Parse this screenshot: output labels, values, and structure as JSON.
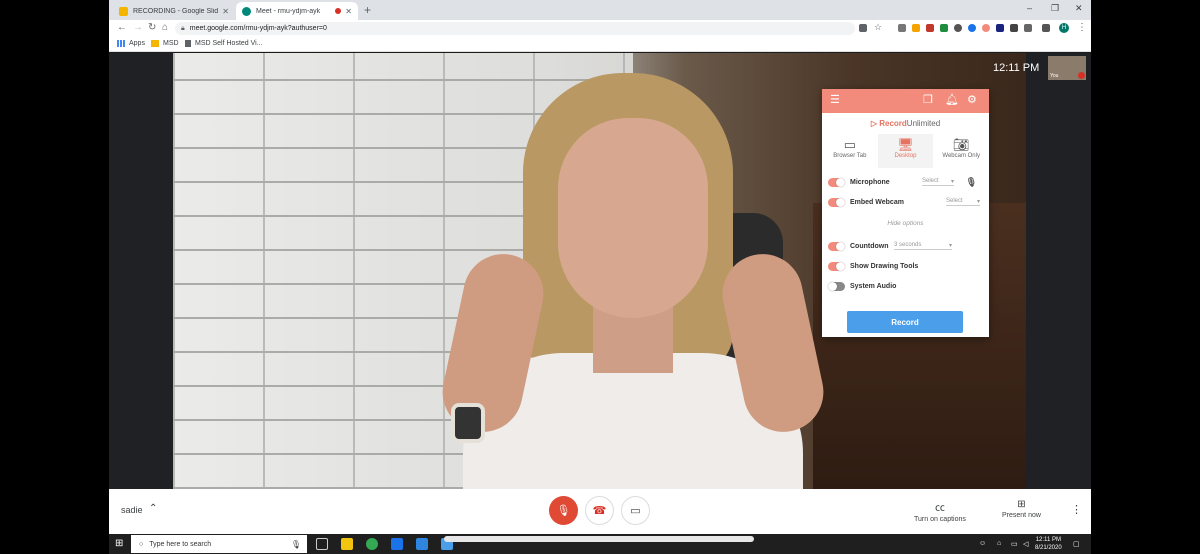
{
  "browser": {
    "tabs": [
      {
        "title": "RECORDING - Google Slides",
        "close": "✕"
      },
      {
        "title": "Meet - rmu-ydjm-ayk",
        "close": "✕"
      }
    ],
    "new_tab": "+",
    "url": "meet.google.com/rmu-ydjm-ayk?authuser=0",
    "profile_initial": "H",
    "bookmarks": [
      "Apps",
      "MSD",
      "MSD Self Hosted Vi..."
    ]
  },
  "meet": {
    "clock": "12:11 PM",
    "self_label": "You",
    "participant_name": "sadie",
    "captions_label": "Turn on captions",
    "present_label": "Present now"
  },
  "popup": {
    "brand_prefix": "Record",
    "brand_suffix": "Unlimited",
    "modes": [
      {
        "label": "Browser Tab",
        "icon": "browser-tab-icon"
      },
      {
        "label": "Desktop",
        "icon": "desktop-icon",
        "active": true
      },
      {
        "label": "Webcam Only",
        "icon": "camera-icon"
      }
    ],
    "options": {
      "microphone": {
        "label": "Microphone",
        "on": true,
        "select": "Select"
      },
      "embed_webcam": {
        "label": "Embed Webcam",
        "on": true,
        "select": "Select"
      },
      "hide_options": "Hide options",
      "countdown": {
        "label": "Countdown",
        "on": true,
        "select": "3 seconds"
      },
      "drawing_tools": {
        "label": "Show Drawing Tools",
        "on": true
      },
      "system_audio": {
        "label": "System Audio",
        "on": false
      }
    },
    "record_label": "Record",
    "accent": "#f28b7b",
    "button_color": "#4a9eea"
  },
  "taskbar": {
    "search_placeholder": "Type here to search",
    "time": "12:11 PM",
    "date": "8/21/2020"
  }
}
